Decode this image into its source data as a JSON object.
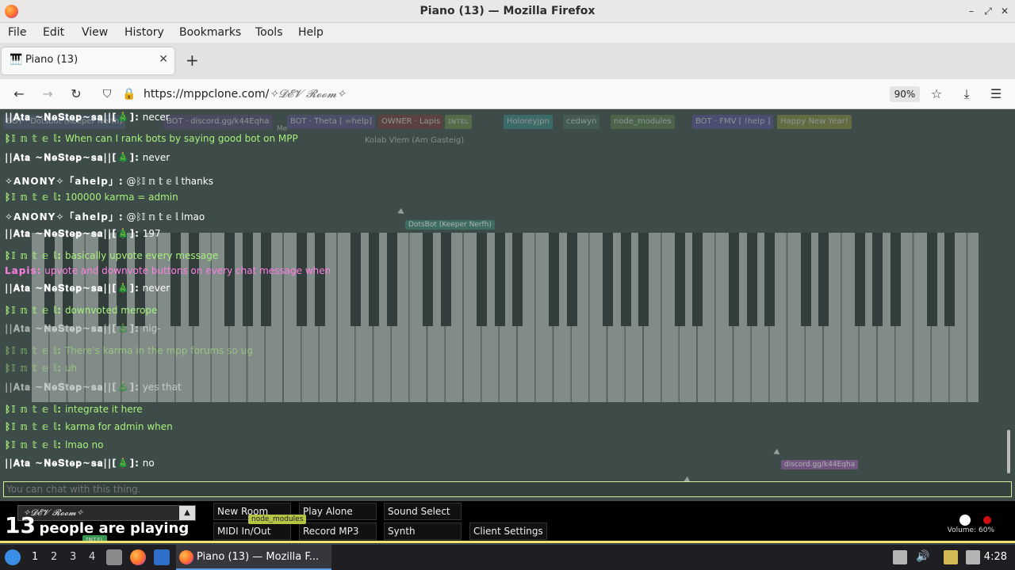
{
  "window": {
    "title": "Piano (13) — Mozilla Firefox",
    "controls": [
      "–",
      "⤢",
      "✕"
    ]
  },
  "menu": [
    "File",
    "Edit",
    "View",
    "History",
    "Bookmarks",
    "Tools",
    "Help"
  ],
  "tab": {
    "title": "Piano (13)",
    "close": "✕",
    "new_tab": "+"
  },
  "nav": {
    "url_host": "https://mppclone.com/",
    "url_path": "✧𝓓𝓔𝓥 𝓡𝓸𝓸𝓶✧",
    "zoom": "90%"
  },
  "badges": [
    "BOT · Dotsbot (Keeper Nerfh)",
    "BOT · discord.gg/k44Eqha",
    "BOT · Theta [ =help]",
    "OWNER · Lapis",
    "ɪɴᴛᴇʟ",
    "Holoreyjpn",
    "cedwyn",
    "node_modules",
    "BOT · FMV [ !help ]",
    "Happy New Year!",
    "Kolab Vlem (Am Gasteig)"
  ],
  "chat": [
    {
      "name": "||𝐀𝐭𝐚 ~𝐍𝐞𝐒𝐭𝐞𝐩~𝐬𝐚||[🎄]:",
      "text": "necer",
      "color": "#ffffff"
    },
    {
      "name": "ᛒ𝕀 𝕟 𝕥 𝕖 𝕝:",
      "text": "When can I rank bots by saying good bot on MPP",
      "color": "#a8f07a"
    },
    {
      "name": "||𝐀𝐭𝐚 ~𝐍𝐞𝐒𝐭𝐞𝐩~𝐬𝐚||[🎄]:",
      "text": "never",
      "color": "#ffffff"
    },
    {
      "name": "✧ANONY✧「ahelp」:",
      "text": "@ᛒ𝕀 𝕟 𝕥 𝕖 𝕝 thanks",
      "color": "#ffffff"
    },
    {
      "name": "ᛒ𝕀 𝕟 𝕥 𝕖 𝕝:",
      "text": "100000 karma = admin",
      "color": "#a8f07a"
    },
    {
      "name": "✧ANONY✧「ahelp」:",
      "text": "@ᛒ𝕀 𝕟 𝕥 𝕖 𝕝 lmao",
      "color": "#ffffff"
    },
    {
      "name": "||𝐀𝐭𝐚 ~𝐍𝐞𝐒𝐭𝐞𝐩~𝐬𝐚||[🎄]:",
      "text": "197",
      "color": "#ffffff"
    },
    {
      "name": "ᛒ𝕀 𝕟 𝕥 𝕖 𝕝:",
      "text": "basically upvote every message",
      "color": "#a8f07a"
    },
    {
      "name": "Lapis:",
      "text": "upvote and downvote buttons on every chat message when",
      "color": "#ff7fe0"
    },
    {
      "name": "||𝐀𝐭𝐚 ~𝐍𝐞𝐒𝐭𝐞𝐩~𝐬𝐚||[🎄]:",
      "text": "never",
      "color": "#ffffff"
    },
    {
      "name": "ᛒ𝕀 𝕟 𝕥 𝕖 𝕝:",
      "text": "downvoted merope",
      "color": "#a8f07a"
    },
    {
      "name": "||𝐀𝐭𝐚 ~𝐍𝐞𝐒𝐭𝐞𝐩~𝐬𝐚||[🎄]:",
      "text": "nig-",
      "color": "#ffffff"
    },
    {
      "name": "ᛒ𝕀 𝕟 𝕥 𝕖 𝕝:",
      "text": "There's karma in the mpp forums so ug",
      "color": "#a8f07a"
    },
    {
      "name": "ᛒ𝕀 𝕟 𝕥 𝕖 𝕝:",
      "text": "uh",
      "color": "#a8f07a"
    },
    {
      "name": "||𝐀𝐭𝐚 ~𝐍𝐞𝐒𝐭𝐞𝐩~𝐬𝐚||[🎄]:",
      "text": "yes that",
      "color": "#ffffff"
    },
    {
      "name": "ᛒ𝕀 𝕟 𝕥 𝕖 𝕝:",
      "text": "integrate it here",
      "color": "#a8f07a"
    },
    {
      "name": "ᛒ𝕀 𝕟 𝕥 𝕖 𝕝:",
      "text": "karma for admin when",
      "color": "#a8f07a"
    },
    {
      "name": "ᛒ𝕀 𝕟 𝕥 𝕖 𝕝:",
      "text": "lmao no",
      "color": "#a8f07a"
    },
    {
      "name": "||𝐀𝐭𝐚 ~𝐍𝐞𝐒𝐭𝐞𝐩~𝐬𝐚||[🎄]:",
      "text": "no",
      "color": "#ffffff"
    }
  ],
  "floating_labels": [
    "DotsBot (Keeper Nerfh)",
    "discord.gg/k44Eqha",
    "node_modules",
    "ɪɴᴛᴇʟ",
    "Me"
  ],
  "chat_input": {
    "placeholder": "You can chat with this thing."
  },
  "room_select": {
    "value": "✧𝓓𝓔𝓥 𝓡𝓸𝓸𝓶✧",
    "arrow": "▲"
  },
  "players": {
    "count": "13",
    "text": "people are playing"
  },
  "buttons": {
    "new_room": "New Room",
    "play_alone": "Play Alone",
    "sound_select": "Sound Select",
    "midi": "MIDI In/Out",
    "record_mp3": "Record MP3",
    "synth": "Synth",
    "client_settings": "Client Settings"
  },
  "volume": {
    "label": "Volume: 60%",
    "level": 0.6
  },
  "taskbar": {
    "workspaces": [
      "1",
      "2",
      "3",
      "4"
    ],
    "task_label": "Piano (13) — Mozilla F...",
    "clock": "4:28"
  },
  "colors": {
    "content_bg": "#3d4c49",
    "intel_green": "#a8f07a",
    "lapis_pink": "#ff7fe0",
    "input_border": "#ddeb9a"
  }
}
